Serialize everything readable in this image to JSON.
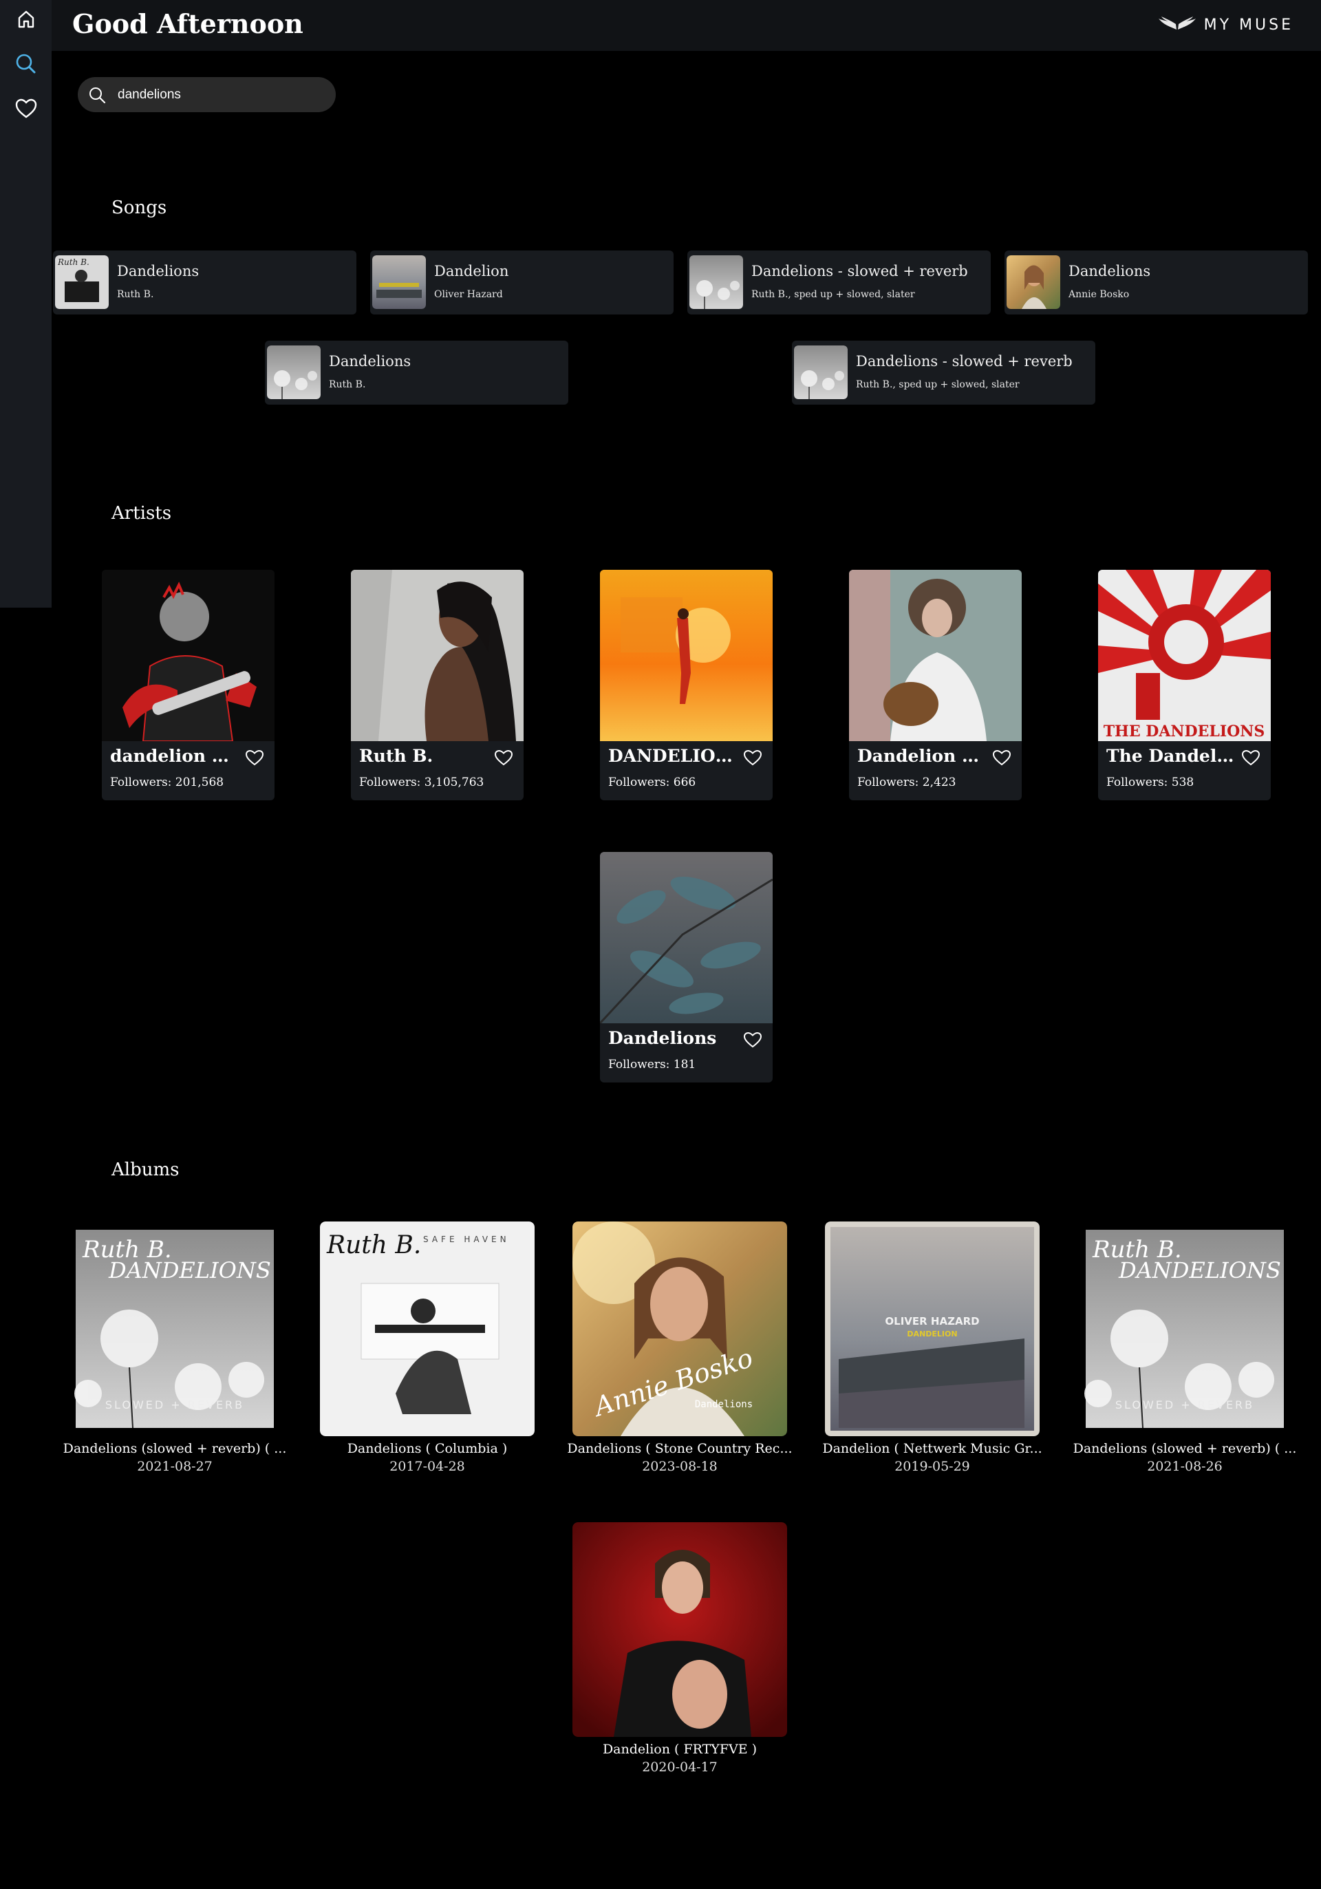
{
  "header": {
    "greeting": "Good Afternoon",
    "logo_text": "MY MUSE"
  },
  "sidebar": {
    "items": [
      {
        "icon": "home-icon"
      },
      {
        "icon": "search-icon",
        "active": true
      },
      {
        "icon": "heart-icon"
      }
    ]
  },
  "search": {
    "value": "dandelions",
    "placeholder": ""
  },
  "colors": {
    "accent": "#4fb3e8",
    "card": "#181b1f",
    "sidebar": "#181b20"
  },
  "songs": {
    "title": "Songs",
    "items": [
      {
        "title": "Dandelions",
        "artist": "Ruth B."
      },
      {
        "title": "Dandelion",
        "artist": "Oliver Hazard"
      },
      {
        "title": "Dandelions - slowed + reverb",
        "artist": "Ruth B., sped up + slowed, slater"
      },
      {
        "title": "Dandelions",
        "artist": "Annie Bosko"
      },
      {
        "title": "Dandelions",
        "artist": "Ruth B."
      },
      {
        "title": "Dandelions - slowed + reverb",
        "artist": "Ruth B., sped up + slowed, slater"
      }
    ]
  },
  "artists": {
    "title": "Artists",
    "items": [
      {
        "name": "dandelion hard",
        "followers": "Followers: 201,568"
      },
      {
        "name": "Ruth B.",
        "followers": "Followers: 3,105,763"
      },
      {
        "name": "DANDELIONS",
        "followers": "Followers: 666"
      },
      {
        "name": "Dandelion Hearts",
        "followers": "Followers: 2,423"
      },
      {
        "name": "The Dandelions",
        "followers": "Followers: 538",
        "image_text": "THE DANDELIONS"
      },
      {
        "name": "Dandelions",
        "followers": "Followers: 181"
      }
    ]
  },
  "albums": {
    "title": "Albums",
    "items": [
      {
        "title": "Dandelions (slowed + reverb) ( ...",
        "date": "2021-08-27",
        "cover_line1": "Ruth B.",
        "cover_line2": "DANDELIONS",
        "cover_line3": "SLOWED + REVERB"
      },
      {
        "title": "Dandelions ( Columbia )",
        "date": "2017-04-28",
        "cover_line1": "Ruth B.",
        "cover_line2": "SAFE HAVEN"
      },
      {
        "title": "Dandelions ( Stone Country Rec...",
        "date": "2023-08-18",
        "cover_line1": "Annie Bosko",
        "cover_line2": "Dandelions"
      },
      {
        "title": "Dandelion ( Nettwerk Music Gr...",
        "date": "2019-05-29",
        "cover_line1": "OLIVER HAZARD",
        "cover_line2": "DANDELION"
      },
      {
        "title": "Dandelions (slowed + reverb) ( ...",
        "date": "2021-08-26",
        "cover_line1": "Ruth B.",
        "cover_line2": "DANDELIONS",
        "cover_line3": "SLOWED + REVERB"
      },
      {
        "title": "Dandelion ( FRTYFVE )",
        "date": "2020-04-17"
      }
    ]
  }
}
